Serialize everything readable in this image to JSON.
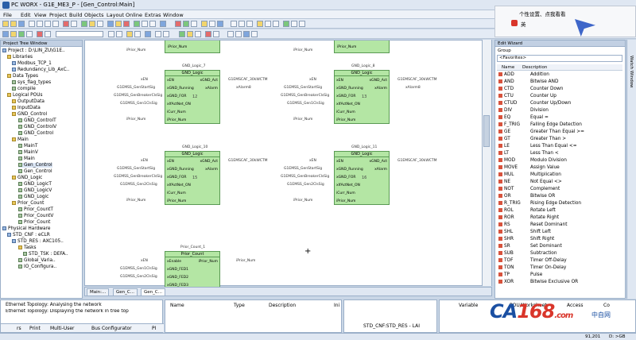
{
  "window": {
    "title": "PC WORX - G1E_ME3_P - [Gen_Control:Main]"
  },
  "menu": [
    "File",
    "Edit",
    "View",
    "Project",
    "Build",
    "Objects",
    "Layout",
    "Online",
    "Extras",
    "Window"
  ],
  "popup": {
    "text": "个性设置、点我看看",
    "sublabel": "英"
  },
  "tree": {
    "title": "Project Tree Window",
    "items": [
      "Project : D:\\LIN_ZU\\G1E..",
      "Libraries",
      "Modbus_TCP_1",
      "Redundancy_Lib_AxC..",
      "Data Types",
      "sys_flag_types",
      "compile",
      "Logical POUs",
      "OutputData",
      "InputData",
      "GND_Control",
      "GND_ControlT",
      "GND_ControlV",
      "GND_Control",
      "Main",
      "MainT",
      "MainV",
      "Main",
      "Gen_Control",
      "Gen_Control",
      "GND_Logic",
      "GND_LogicT",
      "GND_LogicV",
      "GND_Logic",
      "Prior_Count",
      "Prior_CountT",
      "Prior_CountV",
      "Prior_Count",
      "Physical Hardware",
      "STD_CNF : eCLR",
      "STD_RES : AXC105..",
      "Tasks",
      "STD_TSK : DEFA..",
      "Global_Varia..",
      "IO_Configura.."
    ]
  },
  "editor": {
    "blocks": [
      {
        "title": "GND_Logic_7",
        "type": "GND_Logic",
        "num": "12",
        "inputs": [
          "xEN",
          "xGND_Running",
          "xGND_FOR",
          "xIfActNet_ON",
          "iCurr_Num",
          "iPrior_Num"
        ],
        "outputs": [
          "xGND_Act",
          "xAlarm"
        ]
      },
      {
        "title": "GND_Logic_8",
        "type": "GND_Logic",
        "num": "13",
        "inputs": [
          "xEN",
          "xGND_Running",
          "xGND_FOR",
          "xIfActNet_ON",
          "iCurr_Num",
          "iPrior_Num"
        ],
        "outputs": [
          "xGND_Act",
          "xAlarm"
        ]
      },
      {
        "title": "GND_Logic_10",
        "type": "GND_Logic",
        "num": "15",
        "inputs": [
          "xEN",
          "xGND_Running",
          "xGND_FOR",
          "xIfActNet_ON",
          "iCurr_Num",
          "iPrior_Num"
        ],
        "outputs": [
          "xGND_Act",
          "xAlarm"
        ]
      },
      {
        "title": "GND_Logic_11",
        "type": "GND_Logic",
        "num": "16",
        "inputs": [
          "xEN",
          "xGND_Running",
          "xGND_FOR",
          "xIfActNet_ON",
          "iCurr_Num",
          "iPrior_Num"
        ],
        "outputs": [
          "xGND_Act",
          "xAlarm"
        ]
      },
      {
        "title": "Prior_Count_1",
        "type": "Prior_Count",
        "num": "",
        "inputs": [
          "xEnable",
          "xGND_FED1",
          "xGND_FED2",
          "xGND_FED3",
          "xGND_FED4"
        ],
        "outputs": [
          "iPrior_Num"
        ]
      }
    ],
    "labels": {
      "enable": "xEN",
      "prior": "iPrior_Num",
      "curr": "iCurr_Num",
      "gensig": "G1EMSS_GenStartSig",
      "genbrk": "G1EMSS_GenBreakerClsSig",
      "genfedA": "G1EMSS_Gen1ClsSig",
      "genfedB": "G1EMSS_Gen2ClsSig",
      "act": "G1EMSCAF_30kWCTM",
      "alarm": "xAlarm8",
      "top_prior": "iPrior_Num"
    },
    "tabs": [
      "Main:...",
      "Gen_C...",
      "Gen_C..."
    ]
  },
  "right_panel": {
    "title": "Edit Wizard",
    "group_label": "Group",
    "group_value": "<Favorites>",
    "col_name": "Name",
    "col_desc": "Description",
    "items": [
      [
        "ADD",
        "Addition"
      ],
      [
        "AND",
        "Bitwise AND"
      ],
      [
        "CTD",
        "Counter Down"
      ],
      [
        "CTU",
        "Counter Up"
      ],
      [
        "CTUD",
        "Counter Up/Down"
      ],
      [
        "DIV",
        "Division"
      ],
      [
        "EQ",
        "Equal ="
      ],
      [
        "F_TRIG",
        "Falling Edge Detection"
      ],
      [
        "GE",
        "Greater Than Equal >="
      ],
      [
        "GT",
        "Greater Than >"
      ],
      [
        "LE",
        "Less Than Equal <="
      ],
      [
        "LT",
        "Less Than <"
      ],
      [
        "MOD",
        "Modulo Division"
      ],
      [
        "MOVE",
        "Assign Value"
      ],
      [
        "MUL",
        "Multiplication"
      ],
      [
        "NE",
        "Not Equal <>"
      ],
      [
        "NOT",
        "Complement"
      ],
      [
        "OR",
        "Bitwise OR"
      ],
      [
        "R_TRIG",
        "Rising Edge Detection"
      ],
      [
        "ROL",
        "Rotate Left"
      ],
      [
        "ROR",
        "Rotate Right"
      ],
      [
        "RS",
        "Reset Dominant"
      ],
      [
        "SHL",
        "Shift Left"
      ],
      [
        "SHR",
        "Shift Right"
      ],
      [
        "SR",
        "Set Dominant"
      ],
      [
        "SUB",
        "Subtraction"
      ],
      [
        "TOF",
        "Timer Off-Delay"
      ],
      [
        "TON",
        "Timer On-Delay"
      ],
      [
        "TP",
        "Pulse"
      ],
      [
        "XOR",
        "Bitwise Exclusive OR"
      ]
    ],
    "side_label": "Watch Window"
  },
  "messages": {
    "lines": [
      "Ethernet Topology: Analysing the network",
      "Ethernet Topology: Displaying the network in tree top"
    ],
    "tabs": [
      "rs",
      "Print",
      "Multi-User",
      "Bus Configurator",
      "PI"
    ]
  },
  "vars": {
    "cols": [
      "Name",
      "Type",
      "Description",
      "Ini"
    ]
  },
  "path": {
    "value": "STD_CNF:STD_RES - LAI"
  },
  "watch": {
    "cols": [
      "Variable",
      "POU/Worksheet",
      "Access",
      "Co"
    ]
  },
  "logo": {
    "a": "CA",
    "b": "168",
    "c": ".com",
    "d": "中自网"
  },
  "status": {
    "coords": "91,201",
    "zoom": "D: >GB"
  }
}
